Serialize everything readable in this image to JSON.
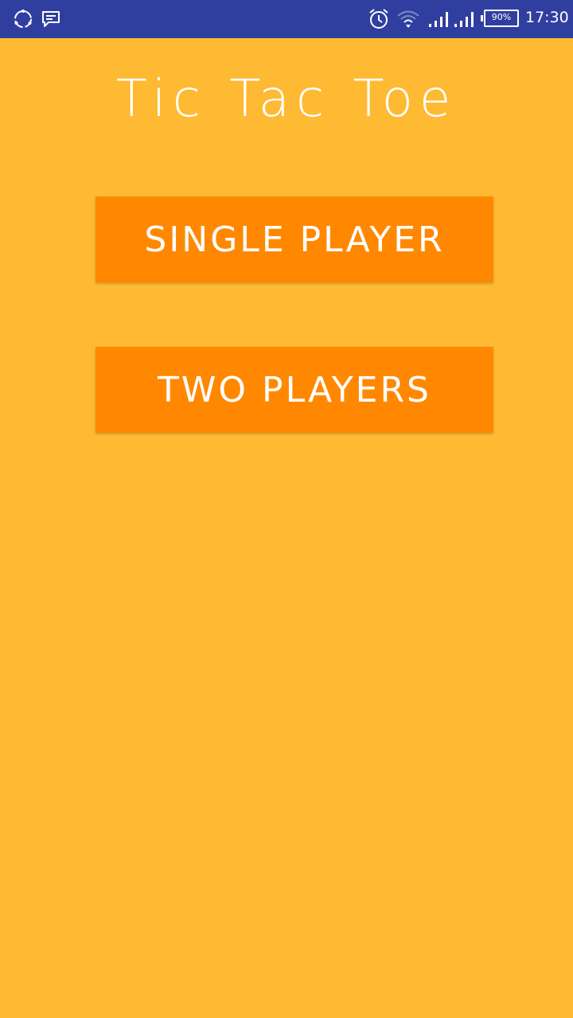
{
  "status_bar": {
    "time": "17:30",
    "battery_percent": "90%",
    "background_color": "#303F9F",
    "left_icons": [
      "sync-icon",
      "message-icon"
    ],
    "right_icons": [
      "alarm-icon",
      "wifi-icon",
      "signal-icon",
      "signal-icon",
      "battery-icon"
    ]
  },
  "app": {
    "title": "Tic Tac Toe",
    "background_color": "#FFBA33",
    "button_color": "#FF8800"
  },
  "menu": {
    "single_player_label": "SINGLE PLAYER",
    "two_players_label": "TWO PLAYERS"
  }
}
